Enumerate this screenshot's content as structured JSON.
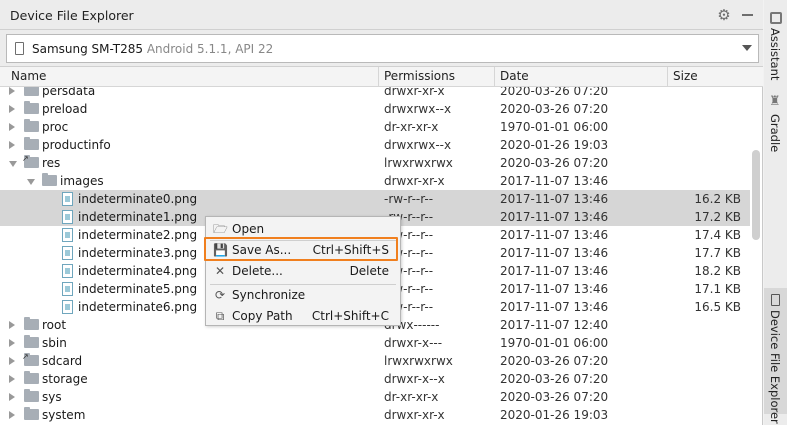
{
  "window": {
    "title": "Device File Explorer"
  },
  "device": {
    "name": "Samsung SM-T285",
    "version": "Android 5.1.1, API 22"
  },
  "columns": {
    "name": "Name",
    "permissions": "Permissions",
    "date": "Date",
    "size": "Size"
  },
  "rows": [
    {
      "name": "persdata",
      "type": "folder",
      "depth": 0,
      "expanded": false,
      "symlink": false,
      "selected": false,
      "permissions": "drwxr-xr-x",
      "date": "2020-03-26 07:20",
      "size": ""
    },
    {
      "name": "preload",
      "type": "folder",
      "depth": 0,
      "expanded": false,
      "symlink": false,
      "selected": false,
      "permissions": "drwxrwx--x",
      "date": "2020-03-26 07:20",
      "size": ""
    },
    {
      "name": "proc",
      "type": "folder",
      "depth": 0,
      "expanded": false,
      "symlink": false,
      "selected": false,
      "permissions": "dr-xr-xr-x",
      "date": "1970-01-01 06:00",
      "size": ""
    },
    {
      "name": "productinfo",
      "type": "folder",
      "depth": 0,
      "expanded": false,
      "symlink": false,
      "selected": false,
      "permissions": "drwxrwx--x",
      "date": "2020-01-26 19:03",
      "size": ""
    },
    {
      "name": "res",
      "type": "folder",
      "depth": 0,
      "expanded": true,
      "symlink": true,
      "selected": false,
      "permissions": "lrwxrwxrwx",
      "date": "2020-03-26 07:20",
      "size": ""
    },
    {
      "name": "images",
      "type": "folder",
      "depth": 1,
      "expanded": true,
      "symlink": false,
      "selected": false,
      "permissions": "drwxr-xr-x",
      "date": "2017-11-07 13:46",
      "size": ""
    },
    {
      "name": "indeterminate0.png",
      "type": "file",
      "depth": 2,
      "selected": true,
      "permissions": "-rw-r--r--",
      "date": "2017-11-07 13:46",
      "size": "16.2 KB"
    },
    {
      "name": "indeterminate1.png",
      "type": "file",
      "depth": 2,
      "selected": true,
      "permissions": "-rw-r--r--",
      "date": "2017-11-07 13:46",
      "size": "17.2 KB"
    },
    {
      "name": "indeterminate2.png",
      "type": "file",
      "depth": 2,
      "selected": false,
      "permissions": "-rw-r--r--",
      "date": "2017-11-07 13:46",
      "size": "17.4 KB"
    },
    {
      "name": "indeterminate3.png",
      "type": "file",
      "depth": 2,
      "selected": false,
      "permissions": "-rw-r--r--",
      "date": "2017-11-07 13:46",
      "size": "17.7 KB"
    },
    {
      "name": "indeterminate4.png",
      "type": "file",
      "depth": 2,
      "selected": false,
      "permissions": "-rw-r--r--",
      "date": "2017-11-07 13:46",
      "size": "18.2 KB"
    },
    {
      "name": "indeterminate5.png",
      "type": "file",
      "depth": 2,
      "selected": false,
      "permissions": "-rw-r--r--",
      "date": "2017-11-07 13:46",
      "size": "17.1 KB"
    },
    {
      "name": "indeterminate6.png",
      "type": "file",
      "depth": 2,
      "selected": false,
      "permissions": "-rw-r--r--",
      "date": "2017-11-07 13:46",
      "size": "16.5 KB"
    },
    {
      "name": "root",
      "type": "folder",
      "depth": 0,
      "expanded": false,
      "symlink": false,
      "selected": false,
      "permissions": "drwx------",
      "date": "2017-11-07 12:40",
      "size": ""
    },
    {
      "name": "sbin",
      "type": "folder",
      "depth": 0,
      "expanded": false,
      "symlink": false,
      "selected": false,
      "permissions": "drwxr-x---",
      "date": "1970-01-01 06:00",
      "size": ""
    },
    {
      "name": "sdcard",
      "type": "folder",
      "depth": 0,
      "expanded": false,
      "symlink": true,
      "selected": false,
      "permissions": "lrwxrwxrwx",
      "date": "2020-03-26 07:20",
      "size": ""
    },
    {
      "name": "storage",
      "type": "folder",
      "depth": 0,
      "expanded": false,
      "symlink": false,
      "selected": false,
      "permissions": "drwxr-x--x",
      "date": "2020-03-26 07:20",
      "size": ""
    },
    {
      "name": "sys",
      "type": "folder",
      "depth": 0,
      "expanded": false,
      "symlink": false,
      "selected": false,
      "permissions": "dr-xr-xr-x",
      "date": "2020-03-26 07:20",
      "size": ""
    },
    {
      "name": "system",
      "type": "folder",
      "depth": 0,
      "expanded": false,
      "symlink": false,
      "selected": false,
      "permissions": "drwxr-xr-x",
      "date": "2020-01-26 19:03",
      "size": ""
    }
  ],
  "context_menu": {
    "items": [
      {
        "id": "open",
        "label": "Open",
        "shortcut": "",
        "icon": "folder-open-icon"
      },
      {
        "id": "save-as",
        "label": "Save As...",
        "shortcut": "Ctrl+Shift+S",
        "icon": "save-icon"
      },
      {
        "id": "delete",
        "label": "Delete...",
        "shortcut": "Delete",
        "icon": "close-icon"
      },
      {
        "id": "synchronize",
        "label": "Synchronize",
        "shortcut": "",
        "icon": "sync-icon"
      },
      {
        "id": "copy-path",
        "label": "Copy Path",
        "shortcut": "Ctrl+Shift+C",
        "icon": "copy-icon"
      }
    ],
    "highlighted": "save-as",
    "highlight_color": "#f07f1e"
  },
  "sidebar": {
    "tabs": [
      {
        "label": "Assistant",
        "icon": "assistant-icon"
      },
      {
        "label": "Gradle",
        "icon": "gradle-icon"
      },
      {
        "label": "Device File Explorer",
        "icon": "device-icon"
      }
    ]
  },
  "colors": {
    "selection": "#d6d6d6",
    "folder": "#a7aeb6",
    "accent": "#f07f1e"
  }
}
